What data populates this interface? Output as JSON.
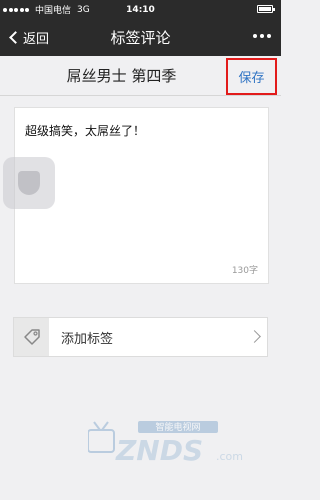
{
  "status_bar": {
    "carrier": "中国电信",
    "network": "3G",
    "time": "14:10"
  },
  "nav": {
    "back_label": "返回",
    "title": "标签评论"
  },
  "header": {
    "show_title": "屌丝男士 第四季",
    "save_label": "保存"
  },
  "comment": {
    "text": "超级搞笑，太屌丝了！",
    "char_count": "130字"
  },
  "tag_row": {
    "label": "添加标签"
  },
  "watermark": {
    "text": "ZNDS",
    "subtext": "智能电视网",
    "suffix": ".com"
  },
  "colors": {
    "bar_bg": "#2b2b2b",
    "save_text": "#2f74c4",
    "highlight_border": "#e21b1b"
  }
}
